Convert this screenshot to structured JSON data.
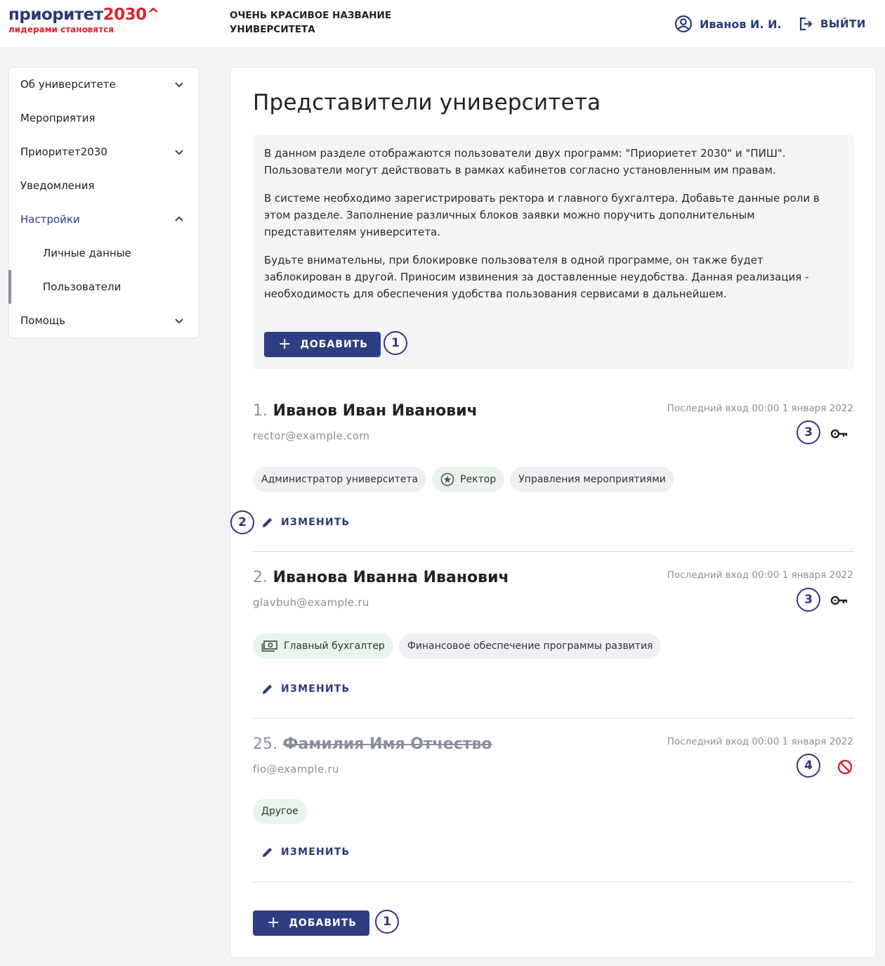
{
  "header": {
    "logo_main": "приоритет",
    "logo_num": "2030",
    "logo_caret": "^",
    "logo_sub": "лидерами становятся",
    "university_name": "ОЧЕНЬ КРАСИВОЕ НАЗВАНИЕ УНИВЕРСИТЕТА",
    "user_name": "Иванов И. И.",
    "logout_label": "ВЫЙТИ"
  },
  "sidebar": {
    "items": [
      {
        "label": "Об университете",
        "icon": "chevron-down-icon"
      },
      {
        "label": "Мероприятия"
      },
      {
        "label": "Приоритет2030",
        "icon": "chevron-down-icon"
      },
      {
        "label": "Уведомления"
      },
      {
        "label": "Настройки",
        "icon": "chevron-up-icon",
        "expanded": true
      },
      {
        "label": "Личные данные",
        "sub": true
      },
      {
        "label": "Пользователи",
        "sub": true,
        "selected": true
      },
      {
        "label": "Помощь",
        "icon": "chevron-down-icon"
      }
    ]
  },
  "main": {
    "title": "Представители университета",
    "info": [
      "В данном разделе отображаются пользователи двух программ: \"Приориетет 2030\" и \"ПИШ\". Пользователи могут действовать в рамках кабинетов согласно установленным им правам.",
      "В системе необходимо зарегистрировать ректора и главного бухгалтера. Добавьте данные роли в этом разделе. Заполнение различных блоков заявки можно поручить дополнительным представителям университета.",
      "Будьте внимательны, при блокировке пользователя в одной программе, он также будет заблокирован в другой. Приносим извинения за доставленные неудобства. Данная реализация - необходимость для обеспечения удобства пользования сервисами в дальнейшем."
    ],
    "add_label": "ДОБАВИТЬ",
    "edit_label": "ИЗМЕНИТЬ",
    "markers": {
      "add": "1",
      "edit": "2",
      "access": "3",
      "blocked": "4"
    },
    "users": [
      {
        "num": "1.",
        "name": "Иванов Иван Иванович",
        "email": "rector@example.com",
        "last_login": "Последний вход 00:00 1 января 2022",
        "roles": [
          "Администратор университета",
          "Ректор",
          "Управления мероприятиями"
        ],
        "status_icon": "key-icon"
      },
      {
        "num": "2.",
        "name": "Иванова Иванна Иванович",
        "email": "glavbuh@example.ru",
        "last_login": "Последний вход 00:00 1 января 2022",
        "roles": [
          "Главный бухгалтер",
          "Финансовое обеспечение программы развития"
        ],
        "status_icon": "key-icon"
      },
      {
        "num": "25.",
        "name": "Фамилия Имя Отчество",
        "email": "fio@example.ru",
        "last_login": "Последний вход 00:00 1 января 2022",
        "roles": [
          "Другое"
        ],
        "status_icon": "blocked-icon"
      }
    ]
  },
  "colors": {
    "brand_blue": "#2b3a77",
    "brand_red": "#d9262e",
    "button": "#2f3e82",
    "marker": "#3b2f7e",
    "blocked": "#d9262e"
  }
}
